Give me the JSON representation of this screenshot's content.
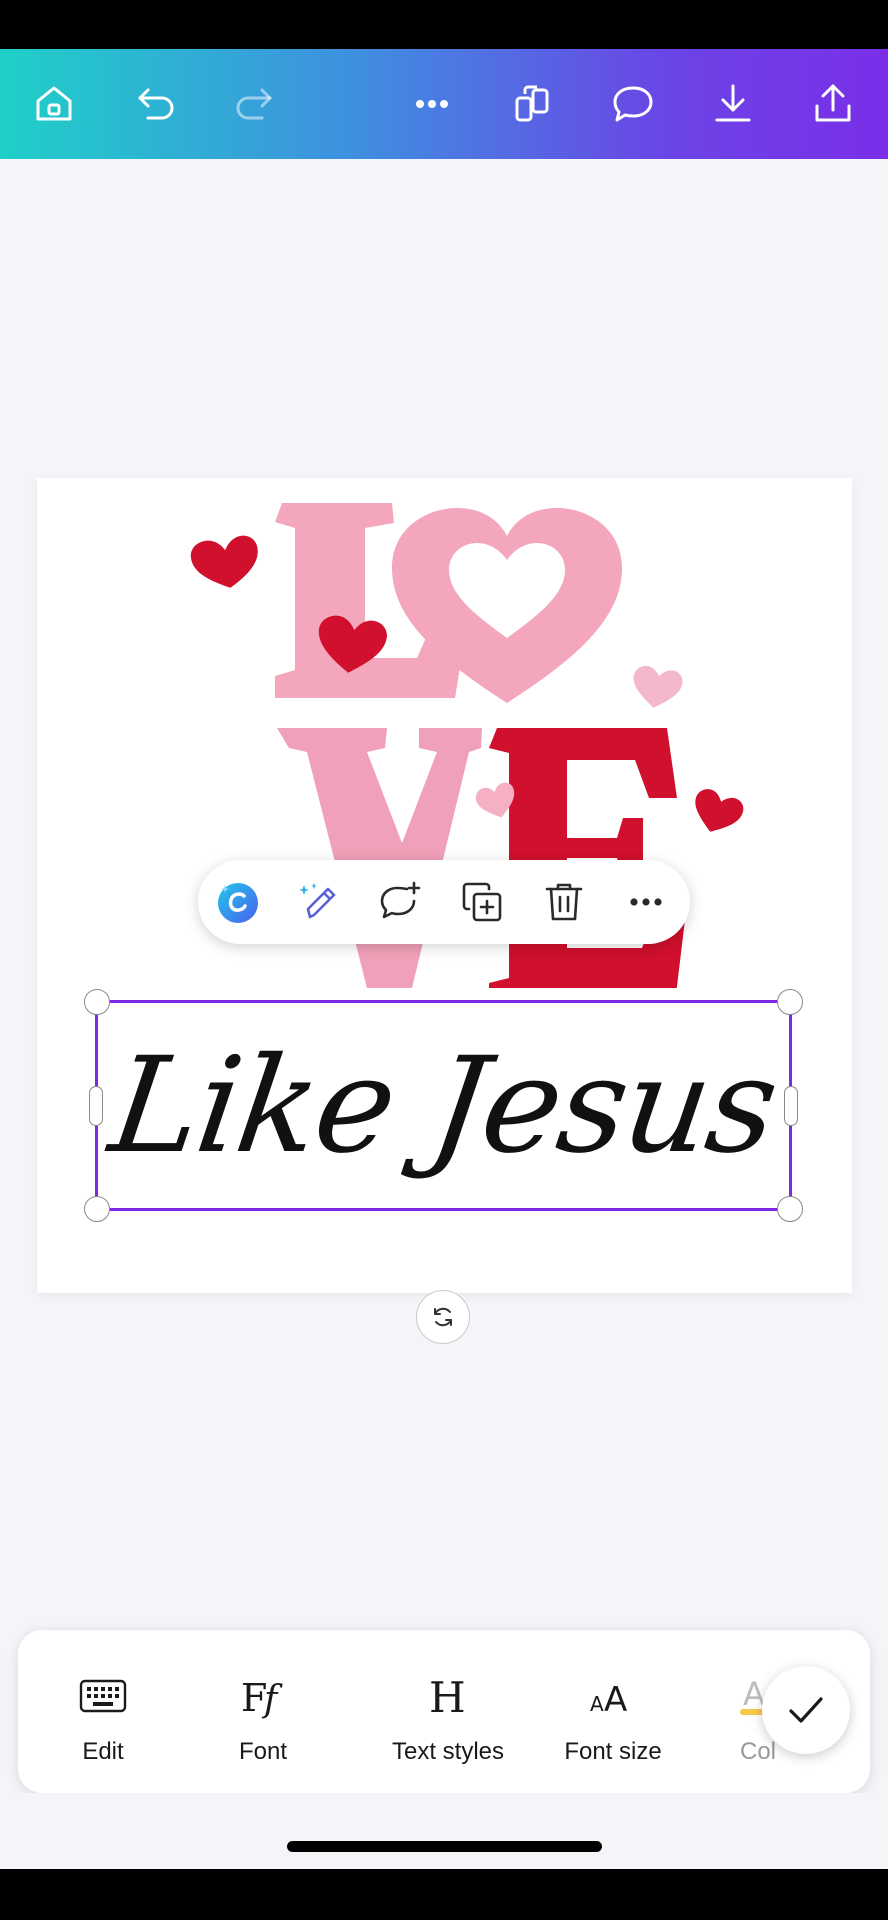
{
  "canvas": {
    "text_element": "Like Jesus"
  },
  "bottom_toolbar": {
    "items": [
      {
        "label": "Edit",
        "icon": "keyboard-icon"
      },
      {
        "label": "Font",
        "icon": "font-icon"
      },
      {
        "label": "Text styles",
        "icon": "text-styles-icon"
      },
      {
        "label": "Font size",
        "icon": "font-size-icon"
      },
      {
        "label": "Col",
        "icon": "color-icon"
      }
    ]
  },
  "graphic": {
    "letters": [
      "L",
      "O",
      "V",
      "E"
    ]
  },
  "colors": {
    "accent": "#7d2ae8",
    "toolbar_gradient_start": "#1fd0c8",
    "toolbar_gradient_end": "#7b2ee8",
    "pink": "#f4a6bd",
    "red": "#d0102c"
  },
  "icons": {
    "toolbar": [
      "home-icon",
      "undo-icon",
      "redo-icon",
      "more-icon",
      "pages-icon",
      "comment-icon",
      "download-icon",
      "share-icon"
    ],
    "context_menu": [
      "canva-assistant-icon",
      "magic-edit-icon",
      "add-comment-icon",
      "duplicate-icon",
      "delete-icon",
      "more-icon"
    ]
  }
}
